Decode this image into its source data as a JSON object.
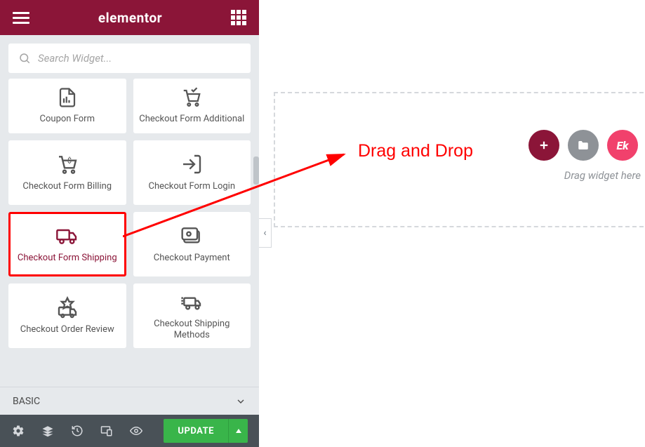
{
  "header": {
    "title": "elementor"
  },
  "search": {
    "placeholder": "Search Widget..."
  },
  "widgets": [
    {
      "label": "Coupon Form",
      "icon": "coupon-icon"
    },
    {
      "label": "Checkout Form Additional",
      "icon": "cart-additional-icon"
    },
    {
      "label": "Checkout Form Billing",
      "icon": "cart-billing-icon"
    },
    {
      "label": "Checkout Form Login",
      "icon": "login-icon"
    },
    {
      "label": "Checkout Form Shipping",
      "icon": "truck-icon",
      "highlight": true
    },
    {
      "label": "Checkout Payment",
      "icon": "payment-icon"
    },
    {
      "label": "Checkout Order Review",
      "icon": "order-review-icon"
    },
    {
      "label": "Checkout Shipping Methods",
      "icon": "shipping-methods-icon"
    }
  ],
  "category": {
    "label": "BASIC"
  },
  "bottombar": {
    "update_label": "UPDATE"
  },
  "canvas": {
    "drag_hint": "Drag widget here"
  },
  "annotation": {
    "text": "Drag and Drop"
  }
}
